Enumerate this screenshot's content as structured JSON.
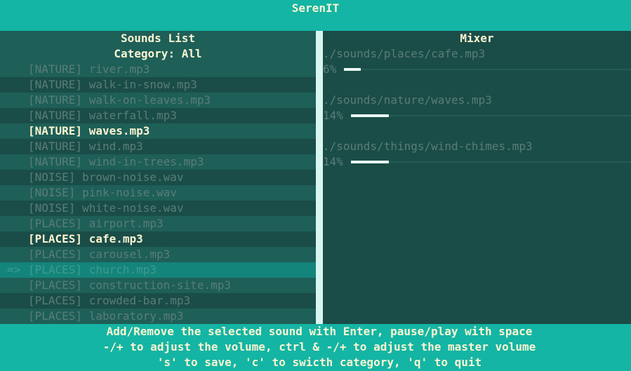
{
  "app": {
    "title": "SerenIT"
  },
  "sounds_panel": {
    "title": "Sounds List",
    "category_label": "Category: All",
    "cursor_marker": "=>",
    "items": [
      {
        "category": "[NATURE]",
        "file": "river.mp3",
        "state": "normal"
      },
      {
        "category": "[NATURE]",
        "file": "walk-in-snow.mp3",
        "state": "normal"
      },
      {
        "category": "[NATURE]",
        "file": "walk-on-leaves.mp3",
        "state": "normal"
      },
      {
        "category": "[NATURE]",
        "file": "waterfall.mp3",
        "state": "normal"
      },
      {
        "category": "[NATURE]",
        "file": "waves.mp3",
        "state": "active"
      },
      {
        "category": "[NATURE]",
        "file": "wind.mp3",
        "state": "normal"
      },
      {
        "category": "[NATURE]",
        "file": "wind-in-trees.mp3",
        "state": "normal"
      },
      {
        "category": "[NOISE]",
        "file": "brown-noise.wav",
        "state": "normal"
      },
      {
        "category": "[NOISE]",
        "file": "pink-noise.wav",
        "state": "normal"
      },
      {
        "category": "[NOISE]",
        "file": "white-noise.wav",
        "state": "normal"
      },
      {
        "category": "[PLACES]",
        "file": "airport.mp3",
        "state": "normal"
      },
      {
        "category": "[PLACES]",
        "file": "cafe.mp3",
        "state": "active"
      },
      {
        "category": "[PLACES]",
        "file": "carousel.mp3",
        "state": "normal"
      },
      {
        "category": "[PLACES]",
        "file": "church.mp3",
        "state": "cursor"
      },
      {
        "category": "[PLACES]",
        "file": "construction-site.mp3",
        "state": "normal"
      },
      {
        "category": "[PLACES]",
        "file": "crowded-bar.mp3",
        "state": "normal"
      },
      {
        "category": "[PLACES]",
        "file": "laboratory.mp3",
        "state": "normal"
      }
    ]
  },
  "mixer_panel": {
    "title": "Mixer",
    "tracks": [
      {
        "path": "./sounds/places/cafe.mp3",
        "volume_label": "6%",
        "volume": 0.06
      },
      {
        "path": "./sounds/nature/waves.mp3",
        "volume_label": "14%",
        "volume": 0.14
      },
      {
        "path": "./sounds/things/wind-chimes.mp3",
        "volume_label": "14%",
        "volume": 0.14
      }
    ]
  },
  "help": {
    "lines": [
      "Add/Remove the selected sound with Enter, pause/play with space",
      "-/+ to adjust the volume, ctrl & -/+ to adjust the master volume",
      "'s' to save, 'c' to swicth category, 'q' to quit"
    ]
  },
  "colors": {
    "accent": "#14b5a4",
    "highlight_text": "#fdf4d2",
    "muted_text": "#5b7c78",
    "cursor_row": "#14857a",
    "gauge_fill": "#e8f6f1"
  }
}
